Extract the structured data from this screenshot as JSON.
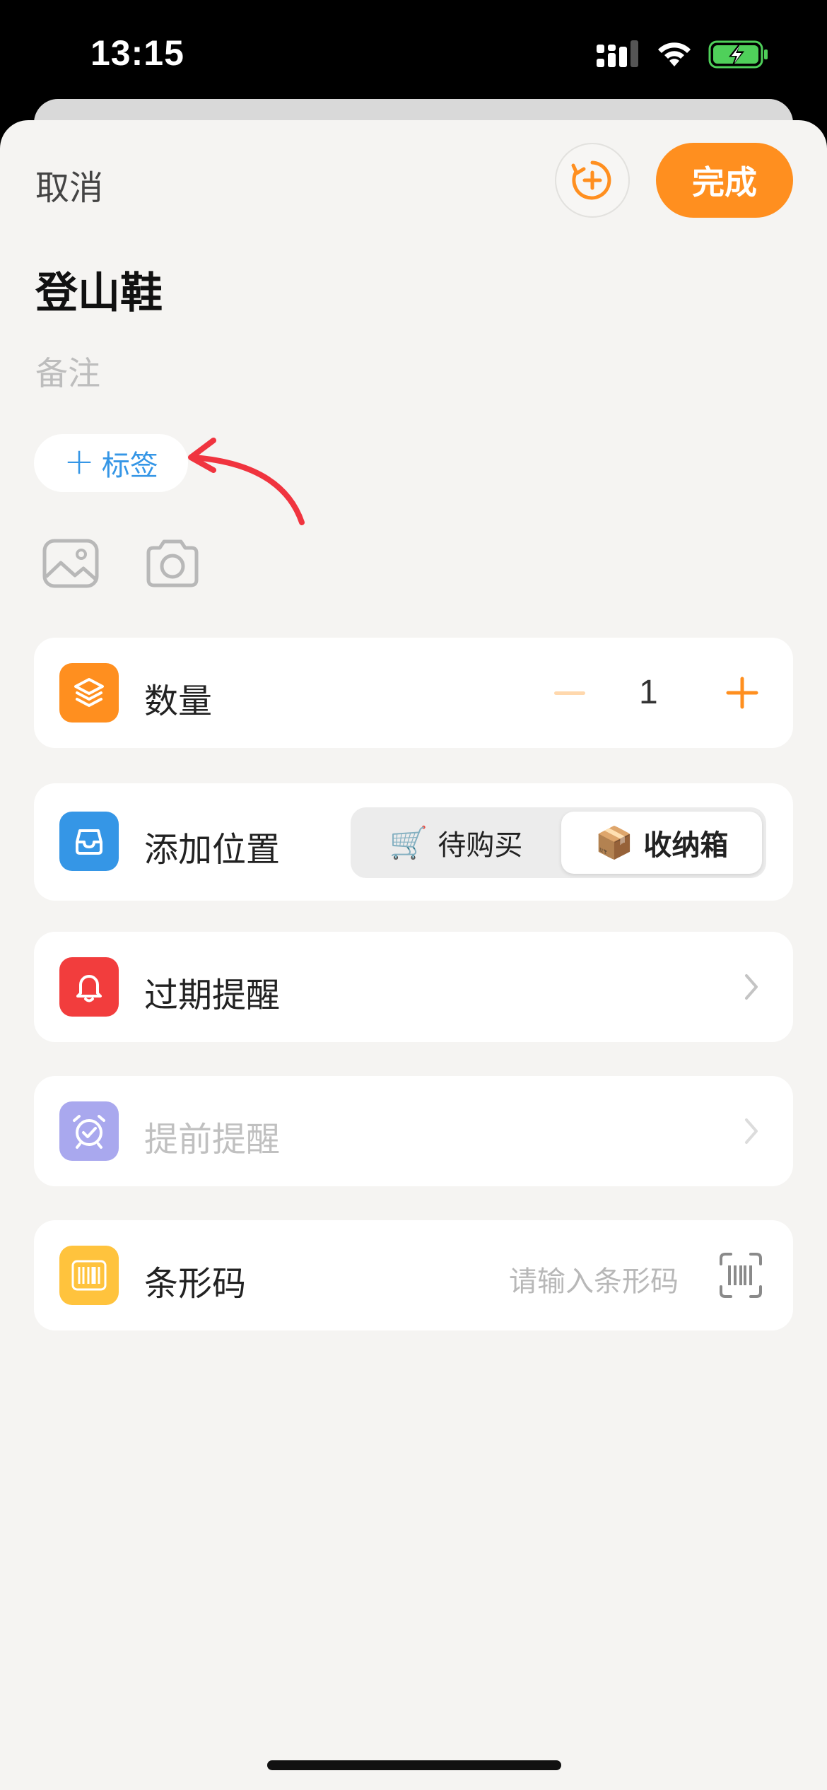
{
  "status_bar": {
    "time": "13:15",
    "signal_icon": "signal-bars-icon",
    "wifi_icon": "wifi-icon",
    "battery_icon": "battery-charging-icon"
  },
  "header": {
    "cancel_label": "取消",
    "done_label": "完成",
    "add_icon": "add-circle-icon",
    "accent": "#ff8f1f"
  },
  "item": {
    "title": "登山鞋",
    "note_placeholder": "备注"
  },
  "tag": {
    "label": "标签",
    "plus": "+"
  },
  "media": {
    "photo_icon": "photo-icon",
    "camera_icon": "camera-icon"
  },
  "quantity": {
    "label": "数量",
    "value": "1",
    "icon": "layers-icon",
    "icon_color": "#ff8f1f"
  },
  "location": {
    "label": "添加位置",
    "icon": "tray-icon",
    "icon_color": "#3596e6",
    "options": [
      {
        "emoji": "🛒",
        "label": "待购买",
        "selected": false
      },
      {
        "emoji": "📦",
        "label": "收纳箱",
        "selected": true
      }
    ]
  },
  "expiry": {
    "label": "过期提醒",
    "icon": "bell-icon",
    "icon_color": "#f23d3d"
  },
  "advance": {
    "label": "提前提醒",
    "icon": "alarm-clock-icon",
    "icon_color": "#a9a8ee"
  },
  "barcode": {
    "label": "条形码",
    "placeholder": "请输入条形码",
    "icon": "barcode-icon",
    "icon_color": "#ffc33d",
    "scan_icon": "scan-barcode-icon"
  }
}
